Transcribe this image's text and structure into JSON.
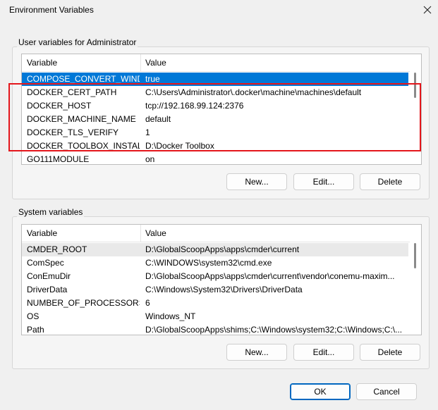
{
  "window": {
    "title": "Environment Variables"
  },
  "user_group": {
    "label": "User variables for Administrator",
    "columns": [
      "Variable",
      "Value"
    ],
    "rows": [
      {
        "variable": "COMPOSE_CONVERT_WIND...",
        "value": "true",
        "selected": true
      },
      {
        "variable": "DOCKER_CERT_PATH",
        "value": "C:\\Users\\Administrator\\.docker\\machine\\machines\\default"
      },
      {
        "variable": "DOCKER_HOST",
        "value": "tcp://192.168.99.124:2376"
      },
      {
        "variable": "DOCKER_MACHINE_NAME",
        "value": "default"
      },
      {
        "variable": "DOCKER_TLS_VERIFY",
        "value": "1"
      },
      {
        "variable": "DOCKER_TOOLBOX_INSTALL...",
        "value": "D:\\Docker Toolbox"
      },
      {
        "variable": "GO111MODULE",
        "value": "on"
      }
    ],
    "buttons": {
      "new": "New...",
      "edit": "Edit...",
      "delete": "Delete"
    }
  },
  "system_group": {
    "label": "System variables",
    "columns": [
      "Variable",
      "Value"
    ],
    "rows": [
      {
        "variable": "CMDER_ROOT",
        "value": "D:\\GlobalScoopApps\\apps\\cmder\\current",
        "light": true
      },
      {
        "variable": "ComSpec",
        "value": "C:\\WINDOWS\\system32\\cmd.exe"
      },
      {
        "variable": "ConEmuDir",
        "value": "D:\\GlobalScoopApps\\apps\\cmder\\current\\vendor\\conemu-maxim..."
      },
      {
        "variable": "DriverData",
        "value": "C:\\Windows\\System32\\Drivers\\DriverData"
      },
      {
        "variable": "NUMBER_OF_PROCESSORS",
        "value": "6"
      },
      {
        "variable": "OS",
        "value": "Windows_NT"
      },
      {
        "variable": "Path",
        "value": "D:\\GlobalScoopApps\\shims;C:\\Windows\\system32;C:\\Windows;C:\\..."
      }
    ],
    "buttons": {
      "new": "New...",
      "edit": "Edit...",
      "delete": "Delete"
    }
  },
  "footer": {
    "ok": "OK",
    "cancel": "Cancel"
  },
  "colors": {
    "selection": "#0078d7",
    "highlight_box": "#e4161b",
    "primary_border": "#0067c0"
  },
  "icons": {
    "close": "close-icon"
  }
}
